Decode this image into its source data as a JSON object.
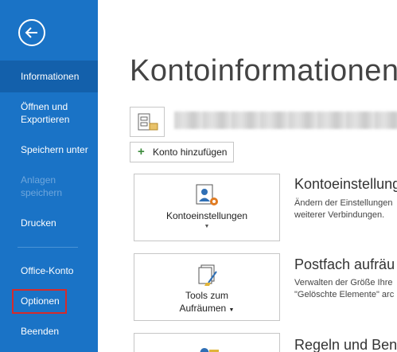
{
  "sidebar": {
    "back_icon": "back-arrow-icon",
    "items": [
      {
        "label": "Informationen",
        "state": "active"
      },
      {
        "label": "Öffnen und",
        "label2": "Exportieren"
      },
      {
        "label": "Speichern unter"
      },
      {
        "label": "Anlagen",
        "label2": "speichern",
        "state": "disabled"
      },
      {
        "label": "Drucken"
      },
      {
        "label": "Office-Konto"
      },
      {
        "label": "Optionen",
        "highlight_color": "#d52b2b"
      },
      {
        "label": "Beenden"
      }
    ]
  },
  "main": {
    "title": "Kontoinformationen",
    "add_account_label": "Konto hinzufügen",
    "sections": [
      {
        "button_label": "Kontoeinstellungen",
        "title": "Kontoeinstellung",
        "desc_line1": "Ändern der Einstellungen",
        "desc_line2": "weiterer Verbindungen."
      },
      {
        "button_label": "Tools zum",
        "button_label2": "Aufräumen",
        "title": "Postfach aufräu",
        "desc_line1": "Verwalten der Größe Ihre",
        "desc_line2": "\"Gelöschte Elemente\" arc"
      },
      {
        "title": "Regeln und Bena"
      }
    ]
  },
  "colors": {
    "sidebar": "#1a73c6",
    "sidebar_active": "#1360ab",
    "highlight": "#d52b2b"
  }
}
